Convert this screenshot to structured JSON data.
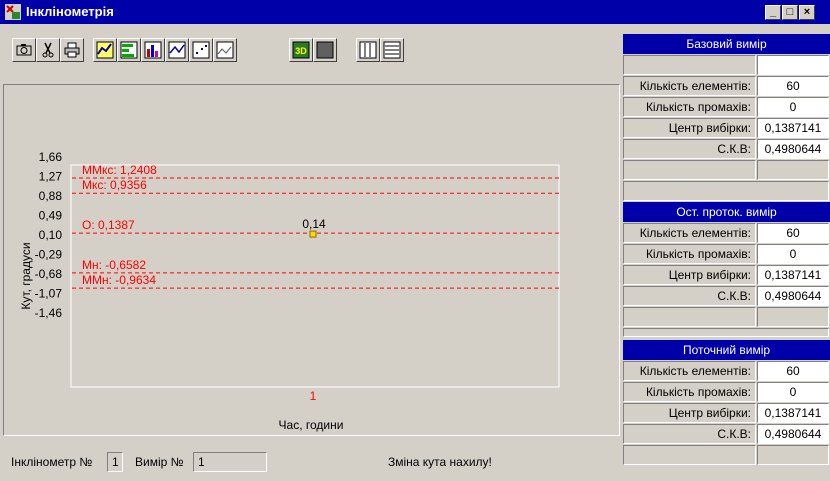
{
  "window": {
    "title": "Інклінометрія"
  },
  "toolbar": {
    "buttons": [
      "camera-icon",
      "scissors-icon",
      "printer-icon",
      "line-chart-icon",
      "horizontal-bar-icon",
      "bar-chart-icon",
      "area-chart-icon",
      "scatter-chart-icon",
      "step-line-icon",
      "3d-toggle-icon",
      "color-block-icon",
      "columns-icon",
      "list-icon"
    ],
    "three_d_label": "3D"
  },
  "chart_data": {
    "type": "scatter",
    "ylabel": "Кут, градуси",
    "xlabel": "Час, години",
    "y_ticks": [
      "1,66",
      "1,27",
      "0,88",
      "0,49",
      "0,10",
      "-0,29",
      "-0,68",
      "-1,07",
      "-1,46"
    ],
    "y_tick_values": [
      1.66,
      1.27,
      0.88,
      0.49,
      0.1,
      -0.29,
      -0.68,
      -1.07,
      -1.46
    ],
    "ylim": [
      -1.46,
      1.66
    ],
    "x_ticks": [
      "1"
    ],
    "points": [
      {
        "x": 1,
        "y": 0.1387,
        "label": "0,14"
      }
    ],
    "reference_lines": [
      {
        "label": "ММкс: 1,2408",
        "y": 1.2408
      },
      {
        "label": "Мкс: 0,9356",
        "y": 0.9356
      },
      {
        "label": "О: 0,1387",
        "y": 0.1387
      },
      {
        "label": "Мн: -0,6582",
        "y": -0.6582
      },
      {
        "label": "ММн: -0,9634",
        "y": -0.9634
      }
    ],
    "colors": {
      "reference": "#ff0000",
      "point": "#ffd700",
      "tick_x": "#ff0000"
    }
  },
  "status": {
    "inclinometer_label": "Інклінометр №",
    "inclinometer_value": "1",
    "measure_label": "Вимір №",
    "measure_value": "1",
    "message": "Зміна кута нахилу!"
  },
  "panel": {
    "sections": [
      {
        "title": "Базовий вимір",
        "rows": [
          {
            "label": "Кількість елементів:",
            "value": "60"
          },
          {
            "label": "Кількість промахів:",
            "value": "0"
          },
          {
            "label": "Центр вибірки:",
            "value": "0,1387141"
          },
          {
            "label": "С.К.В:",
            "value": "0,4980644"
          }
        ]
      },
      {
        "title": "Ост. проток. вимір",
        "rows": [
          {
            "label": "Кількість елементів:",
            "value": "60"
          },
          {
            "label": "Кількість промахів:",
            "value": "0"
          },
          {
            "label": "Центр вибірки:",
            "value": "0,1387141"
          },
          {
            "label": "С.К.В:",
            "value": "0,4980644"
          }
        ]
      },
      {
        "title": "Поточний вимір",
        "rows": [
          {
            "label": "Кількість елементів:",
            "value": "60"
          },
          {
            "label": "Кількість промахів:",
            "value": "0"
          },
          {
            "label": "Центр вибірки:",
            "value": "0,1387141"
          },
          {
            "label": "С.К.В:",
            "value": "0,4980644"
          }
        ]
      }
    ]
  }
}
